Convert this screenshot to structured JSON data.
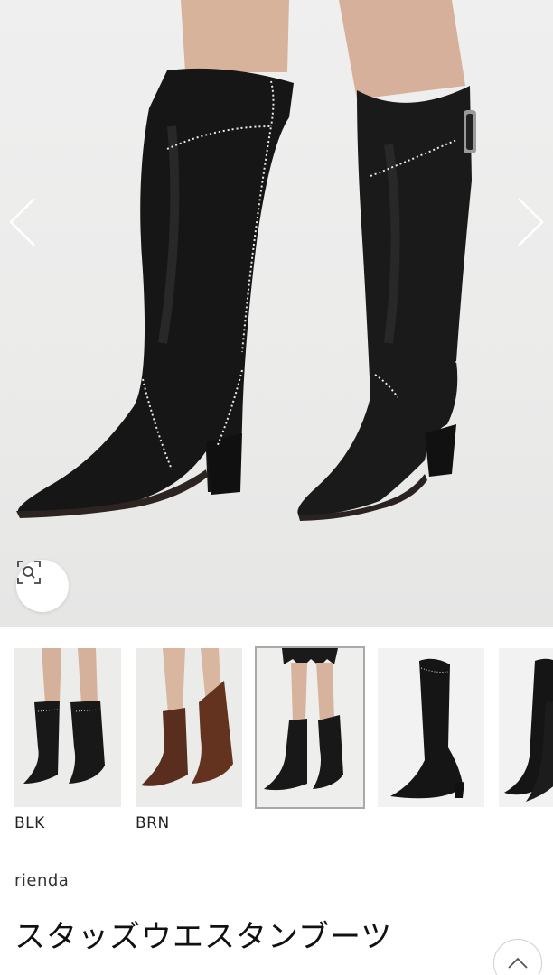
{
  "product": {
    "brand": "rienda",
    "title": "スタッズウエスタンブーツ"
  },
  "gallery": {
    "prev_icon": "chevron-left-icon",
    "next_icon": "chevron-right-icon",
    "zoom_icon": "zoom-search-icon"
  },
  "colors": [
    {
      "code": "BLK",
      "swatch": "#1c1c1c"
    },
    {
      "code": "BRN",
      "swatch": "#5a2e1e"
    }
  ],
  "ui": {
    "back_to_top_icon": "chevron-up-icon",
    "accent": "#111111",
    "selected_outline": "#a9a9a9"
  }
}
